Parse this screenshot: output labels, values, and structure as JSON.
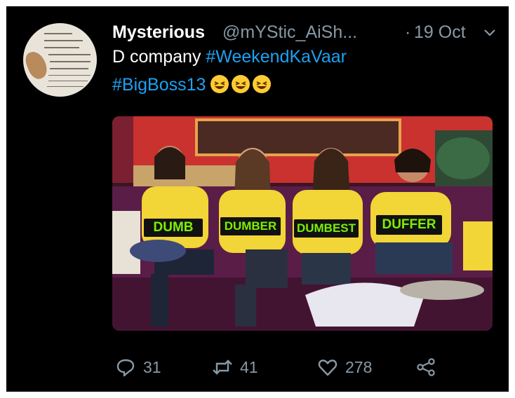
{
  "tweet": {
    "author_name": "Mysterious",
    "author_handle": "@mYStic_AiSh...",
    "separator": "·",
    "date": "19 Oct",
    "text_line1_plain": "D company",
    "text_line1_tag": "#WeekendKaVaar",
    "text_line2_tag": "#BigBoss13",
    "emoji": [
      "grinning-squinting-face",
      "grinning-squinting-face",
      "grinning-squinting-face"
    ]
  },
  "media": {
    "labels": [
      "DUMB",
      "DUMBER",
      "DUMBEST",
      "DUFFER"
    ],
    "label_color": "#7cf000"
  },
  "actions": {
    "reply_count": "31",
    "retweet_count": "41",
    "like_count": "278"
  },
  "colors": {
    "background": "#000000",
    "text": "#ffffff",
    "muted": "#8899a6",
    "link": "#1da1f2"
  },
  "avatar_text": "ਅਸੀ ਘਰ ਹਰਵਾਰ ਅੱਗ ਪਰਾਵਾਰ ਹਰਿ ਕਿਰਪਾ ਕਰਿ ਬਖਸਿ ਲੈਹੁ ਹਉ ਪਾਪੀ ਵਡ ਗੁਨਹਗਾਰ I make so many mistakes, there is no end or limit to them. Lord, please be merciful and forgive me; I am a sinner, a great offender."
}
